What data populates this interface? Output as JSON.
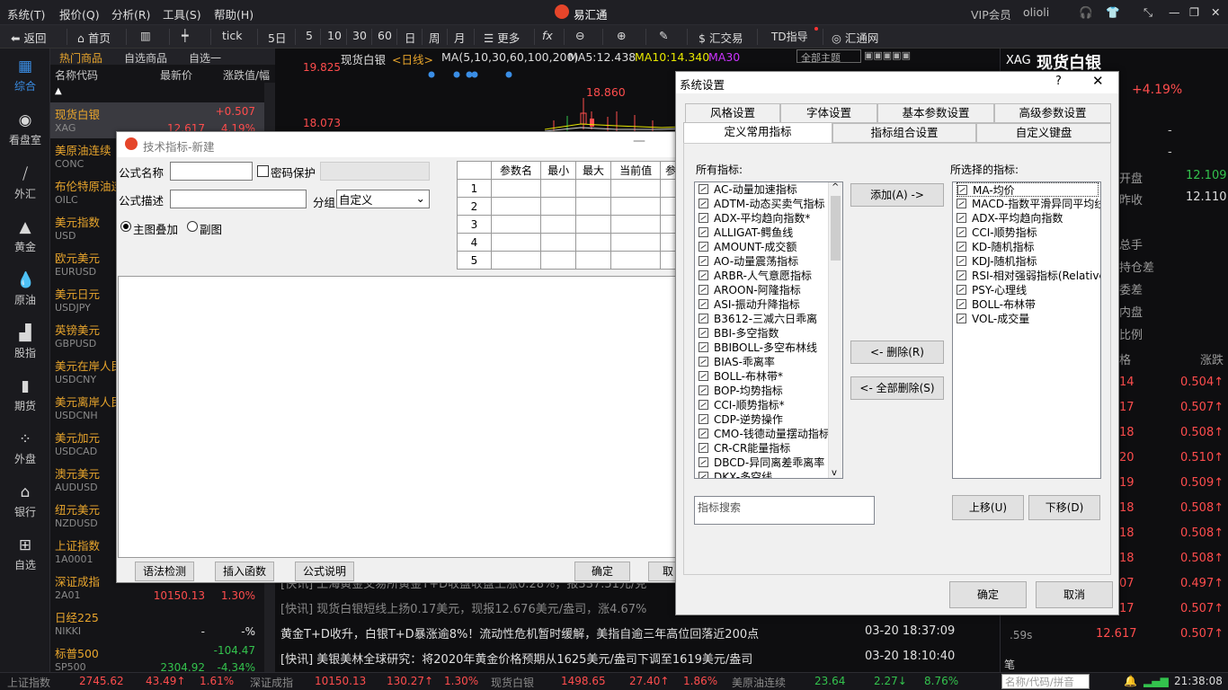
{
  "menu": {
    "items": [
      "系统(T)",
      "报价(Q)",
      "分析(R)",
      "工具(S)",
      "帮助(H)"
    ],
    "app_title": "易汇通",
    "vip": "VIP会员",
    "user": "olioli"
  },
  "toolbar": {
    "back": "返回",
    "home": "首页",
    "tick": "tick",
    "periods": [
      "5日",
      "5",
      "10",
      "30",
      "60",
      "日",
      "周",
      "月"
    ],
    "more": "更多",
    "fx": "fx",
    "trade": "汇交易",
    "td": "TD指导",
    "hub": "汇通网"
  },
  "sidebar": [
    {
      "label": "综合"
    },
    {
      "label": "看盘室"
    },
    {
      "label": "外汇"
    },
    {
      "label": "黄金"
    },
    {
      "label": "原油"
    },
    {
      "label": "股指"
    },
    {
      "label": "期货"
    },
    {
      "label": "外盘"
    },
    {
      "label": "银行"
    },
    {
      "label": "自选"
    }
  ],
  "quotes": {
    "tabs": [
      "热门商品",
      "自选商品",
      "自选一"
    ],
    "head": [
      "名称代码",
      "最新价",
      "涨跌值/幅"
    ],
    "rows": [
      {
        "name": "现货白银",
        "code": "XAG",
        "price": "12.617",
        "chg": "4.19%",
        "up": "+0.507",
        "pc": "red",
        "cc": "red"
      },
      {
        "name": "美原油连续",
        "code": "CONC",
        "price": "",
        "chg": "",
        "up": "",
        "pc": "red",
        "cc": "red"
      },
      {
        "name": "布伦特原油连",
        "code": "OILC",
        "price": "",
        "chg": "",
        "up": "",
        "pc": "red",
        "cc": "red"
      },
      {
        "name": "美元指数",
        "code": "USD",
        "price": "",
        "chg": "",
        "up": "",
        "pc": "red",
        "cc": "red"
      },
      {
        "name": "欧元美元",
        "code": "EURUSD",
        "price": "",
        "chg": "",
        "up": "",
        "pc": "red",
        "cc": "red"
      },
      {
        "name": "美元日元",
        "code": "USDJPY",
        "price": "",
        "chg": "",
        "up": "",
        "pc": "red",
        "cc": "red"
      },
      {
        "name": "英镑美元",
        "code": "GBPUSD",
        "price": "",
        "chg": "",
        "up": "",
        "pc": "red",
        "cc": "red"
      },
      {
        "name": "美元在岸人民",
        "code": "USDCNY",
        "price": "",
        "chg": "",
        "up": "",
        "pc": "red",
        "cc": "red"
      },
      {
        "name": "美元离岸人民",
        "code": "USDCNH",
        "price": "",
        "chg": "",
        "up": "",
        "pc": "red",
        "cc": "red"
      },
      {
        "name": "美元加元",
        "code": "USDCAD",
        "price": "",
        "chg": "",
        "up": "",
        "pc": "red",
        "cc": "red"
      },
      {
        "name": "澳元美元",
        "code": "AUDUSD",
        "price": "",
        "chg": "",
        "up": "",
        "pc": "red",
        "cc": "red"
      },
      {
        "name": "纽元美元",
        "code": "NZDUSD",
        "price": "",
        "chg": "",
        "up": "",
        "pc": "red",
        "cc": "red"
      },
      {
        "name": "上证指数",
        "code": "1A0001",
        "price": "",
        "chg": "",
        "up": "",
        "pc": "red",
        "cc": "red"
      },
      {
        "name": "深证成指",
        "code": "2A01",
        "price": "10150.13",
        "chg": "1.30%",
        "up": "",
        "pc": "red",
        "cc": "red"
      },
      {
        "name": "日经225",
        "code": "NIKKI",
        "price": "-",
        "chg": "-%",
        "up": "",
        "pc": "white",
        "cc": "white"
      },
      {
        "name": "标普500",
        "code": "SP500",
        "price": "2304.92",
        "chg": "-4.34%",
        "up": "-104.47",
        "pc": "green",
        "cc": "green"
      }
    ]
  },
  "chart": {
    "symbol": "现货白银",
    "period": "<日线>",
    "ma_label": "MA(5,10,30,60,100,200)",
    "ma5": "MA5:12.438",
    "ma10": "MA10:14.340",
    "ma30": "MA30",
    "y_top": "19.825",
    "y_mid": "18.073",
    "peak": "18.860",
    "theme": "全部主题"
  },
  "news": [
    {
      "text": "[快讯] 上海黄金交易所黄金T+D收盘收盘上涨0.28%，报337.51元/克",
      "time": ""
    },
    {
      "text": "[快讯] 现货白银短线上扬0.17美元，现报12.676美元/盎司，涨4.67%",
      "time": ""
    },
    {
      "text": "黄金T+D收升，白银T+D暴涨逾8%！流动性危机暂时缓解，美指自逾三年高位回落近200点",
      "time": "03-20 18:37:09"
    },
    {
      "text": "[快讯] 美银美林全球研究：将2020年黄金价格预期从1625美元/盎司下调至1619美元/盎司",
      "time": "03-20 18:10:40"
    }
  ],
  "right": {
    "code": "XAG",
    "name": "现货白银",
    "chg": "+4.19%",
    "dash1": "-",
    "dash2": "-",
    "labels": [
      "开盘",
      "昨收",
      "总手",
      "持仓差",
      "委差",
      "内盘",
      "比例"
    ],
    "open": "12.109",
    "prev": "12.110",
    "col_a": "格",
    "col_b": "涨跌",
    "ticks": [
      {
        "a": "14",
        "b": "0.504↑"
      },
      {
        "a": "17",
        "b": "0.507↑"
      },
      {
        "a": "18",
        "b": "0.508↑"
      },
      {
        "a": "20",
        "b": "0.510↑"
      },
      {
        "a": "19",
        "b": "0.509↑"
      },
      {
        "a": "18",
        "b": "0.508↑"
      },
      {
        "a": "18",
        "b": "0.508↑"
      },
      {
        "a": "18",
        "b": "0.508↑"
      },
      {
        "a": "07",
        "b": "0.497↑"
      },
      {
        "a": "17",
        "b": "0.507↑"
      },
      {
        "a": "12.617",
        "b": "0.507↑"
      }
    ],
    "last_lbl": ".59s",
    "search_tag": "笔"
  },
  "status": {
    "items": [
      {
        "t": "上证指数",
        "c": "gray"
      },
      {
        "t": "2745.62",
        "c": "red"
      },
      {
        "t": "43.49↑",
        "c": "red"
      },
      {
        "t": "1.61%",
        "c": "red"
      },
      {
        "t": "深证成指",
        "c": "gray"
      },
      {
        "t": "10150.13",
        "c": "red"
      },
      {
        "t": "130.27↑",
        "c": "red"
      },
      {
        "t": "1.30%",
        "c": "red"
      },
      {
        "t": "现货白银",
        "c": "gray"
      },
      {
        "t": "1498.65",
        "c": "red"
      },
      {
        "t": "27.40↑",
        "c": "red"
      },
      {
        "t": "1.86%",
        "c": "red"
      },
      {
        "t": "美原油连续",
        "c": "gray"
      },
      {
        "t": "23.64",
        "c": "green"
      },
      {
        "t": "2.27↓",
        "c": "green"
      },
      {
        "t": "8.76%",
        "c": "green"
      }
    ],
    "search_placeholder": "名称/代码/拼音",
    "time": "21:38:08"
  },
  "indicator_dialog": {
    "title": "技术指标-新建",
    "formula_name": "公式名称",
    "password": "密码保护",
    "formula_desc": "公式描述",
    "group": "分组",
    "group_value": "自定义",
    "main_overlay": "主图叠加",
    "sub_chart": "副图",
    "param_head": [
      "参数名",
      "最小",
      "最大",
      "当前值",
      "参"
    ],
    "rows": [
      "1",
      "2",
      "3",
      "4",
      "5"
    ],
    "buttons": [
      "语法检测",
      "插入函数",
      "公式说明",
      "确定",
      "取"
    ]
  },
  "sys_dialog": {
    "title": "系统设置",
    "help": "?",
    "tabs_top": [
      "风格设置",
      "字体设置",
      "基本参数设置",
      "高级参数设置"
    ],
    "tabs_bottom": [
      "定义常用指标",
      "指标组合设置",
      "自定义键盘"
    ],
    "all_label": "所有指标:",
    "selected_label": "所选择的指标:",
    "all": [
      "AC-动量加速指标",
      "ADTM-动态买卖气指标",
      "ADX-平均趋向指数*",
      "ALLIGAT-鳄鱼线",
      "AMOUNT-成交额",
      "AO-动量震荡指标",
      "ARBR-人气意愿指标",
      "AROON-阿隆指标",
      "ASI-振动升降指标",
      "B3612-三减六日乖离",
      "BBI-多空指数",
      "BBIBOLL-多空布林线",
      "BIAS-乖离率",
      "BOLL-布林带*",
      "BOP-均势指标",
      "CCI-顺势指标*",
      "CDP-逆势操作",
      "CMO-钱德动量摆动指标",
      "CR-CR能量指标",
      "DBCD-异同离差乖离率",
      "DKX-多空线"
    ],
    "selected": [
      "MA-均价",
      "MACD-指数平滑异同平均线",
      "ADX-平均趋向指数",
      "CCI-顺势指标",
      "KD-随机指标",
      "KDJ-随机指标",
      "RSI-相对强弱指标(Relative",
      "PSY-心理线",
      "BOLL-布林带",
      "VOL-成交量"
    ],
    "add": "添加(A) ->",
    "remove": "<- 删除(R)",
    "remove_all": "<- 全部删除(S)",
    "search_placeholder": "指标搜索",
    "up": "上移(U)",
    "down": "下移(D)",
    "ok": "确定",
    "cancel": "取消"
  },
  "colors": {
    "accent": "#3a8ee6",
    "up": "#ff4d4d",
    "down": "#33c24d",
    "label": "#e8a52c",
    "ma10": "#e6e600",
    "ma30": "#cc33ff"
  }
}
